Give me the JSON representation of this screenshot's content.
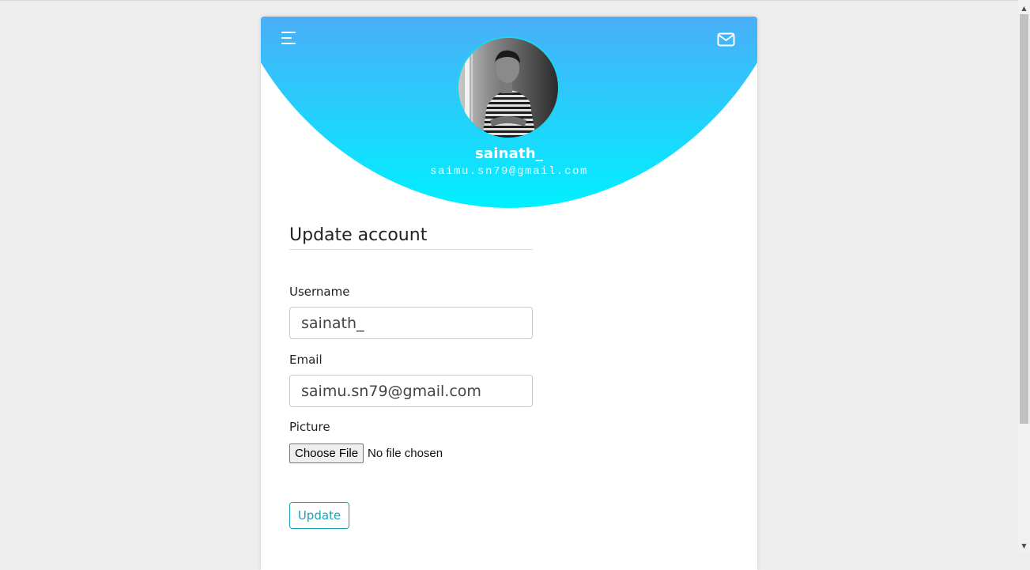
{
  "profile": {
    "name": "sainath_",
    "email": "saimu.sn79@gmail.com",
    "avatar_alt": "profile photo"
  },
  "header": {
    "menu_icon": "hamburger-menu-icon",
    "mail_icon": "envelope-icon",
    "gradient_top": "#4aaef8",
    "gradient_bottom": "#00f0ff"
  },
  "form": {
    "title": "Update account",
    "username_label": "Username",
    "username_value": "sainath_",
    "email_label": "Email",
    "email_value": "saimu.sn79@gmail.com",
    "picture_label": "Picture",
    "file_button_label": "Choose File",
    "file_status": "No file chosen",
    "submit_label": "Update",
    "accent_color": "#17a2b8"
  },
  "scrollbar": {
    "up_arrow": "▲",
    "down_arrow": "▼"
  }
}
